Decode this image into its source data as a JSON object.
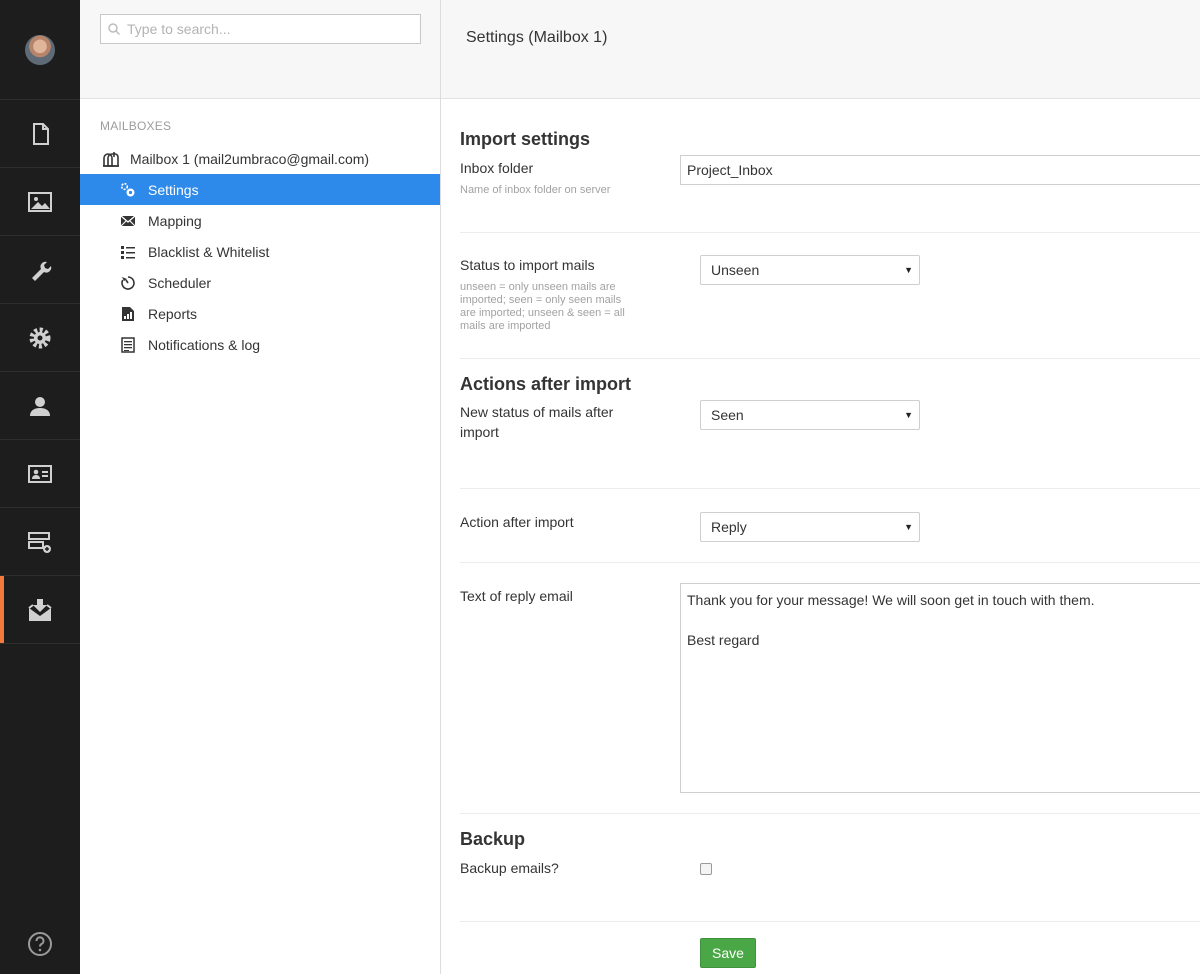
{
  "search": {
    "placeholder": "Type to search..."
  },
  "tree": {
    "heading": "MAILBOXES",
    "root": "Mailbox 1 (mail2umbraco@gmail.com)",
    "items": [
      {
        "label": "Settings",
        "icon": "settings-icon",
        "active": true
      },
      {
        "label": "Mapping",
        "icon": "mapping-icon"
      },
      {
        "label": "Blacklist & Whitelist",
        "icon": "list-icon"
      },
      {
        "label": "Scheduler",
        "icon": "timer-icon"
      },
      {
        "label": "Reports",
        "icon": "report-icon"
      },
      {
        "label": "Notifications & log",
        "icon": "log-icon"
      }
    ]
  },
  "sections": [
    {
      "icon": "content-icon"
    },
    {
      "icon": "media-icon"
    },
    {
      "icon": "wrench-icon"
    },
    {
      "icon": "gear-icon"
    },
    {
      "icon": "user-icon"
    },
    {
      "icon": "member-card-icon"
    },
    {
      "icon": "forms-icon"
    },
    {
      "icon": "mail-import-icon",
      "active": true
    }
  ],
  "accent_color": "#f5793b",
  "selection_color": "#2e8aea",
  "save_color": "#49a845",
  "editor": {
    "title": "Settings (Mailbox 1)",
    "import": {
      "title": "Import settings",
      "inbox_label": "Inbox folder",
      "inbox_desc": "Name of inbox folder on server",
      "inbox_value": "Project_Inbox",
      "status_label": "Status to import mails",
      "status_desc": "unseen = only unseen mails are imported; seen = only seen mails are imported; unseen & seen = all mails are imported",
      "status_value": "Unseen"
    },
    "actions": {
      "title": "Actions after import",
      "new_status_label": "New status of mails after import",
      "new_status_value": "Seen",
      "action_label": "Action after import",
      "action_value": "Reply",
      "reply_label": "Text of reply email",
      "reply_text": "Thank you for your message! We will soon get in touch with them.\n\nBest regard"
    },
    "backup": {
      "title": "Backup",
      "label": "Backup emails?",
      "checked": false
    },
    "save_label": "Save"
  }
}
